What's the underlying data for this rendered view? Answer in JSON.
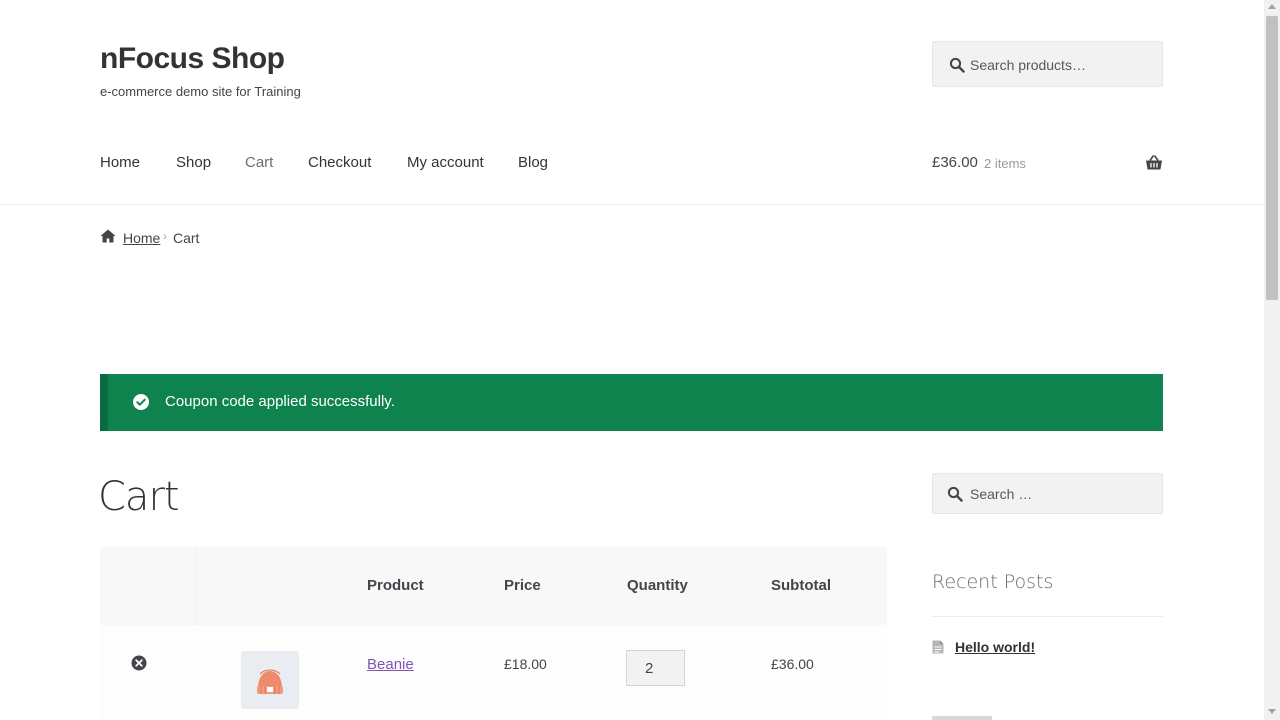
{
  "header": {
    "site_title": "nFocus Shop",
    "site_description": "e-commerce demo site for Training",
    "search_placeholder": "Search products…"
  },
  "nav": {
    "items": [
      {
        "label": "Home"
      },
      {
        "label": "Shop"
      },
      {
        "label": "Cart",
        "active": true
      },
      {
        "label": "Checkout"
      },
      {
        "label": "My account"
      },
      {
        "label": "Blog"
      }
    ]
  },
  "mini_cart": {
    "amount": "£36.00",
    "count": "2 items",
    "icon": "basket-icon"
  },
  "breadcrumb": {
    "home": "Home",
    "separator": "›",
    "current": "Cart"
  },
  "notice": {
    "message": "Coupon code applied successfully.",
    "color": "#0f834d"
  },
  "cart": {
    "title": "Cart",
    "columns": [
      "Product",
      "Price",
      "Quantity",
      "Subtotal"
    ],
    "items": [
      {
        "product": "Beanie",
        "price": "£18.00",
        "quantity": "2",
        "subtotal": "£36.00"
      }
    ]
  },
  "sidebar": {
    "search_placeholder": "Search …",
    "recent_posts_title": "Recent Posts",
    "posts": [
      "Hello world!"
    ]
  },
  "colors": {
    "link": "#7f54b3",
    "success": "#0f834d"
  }
}
